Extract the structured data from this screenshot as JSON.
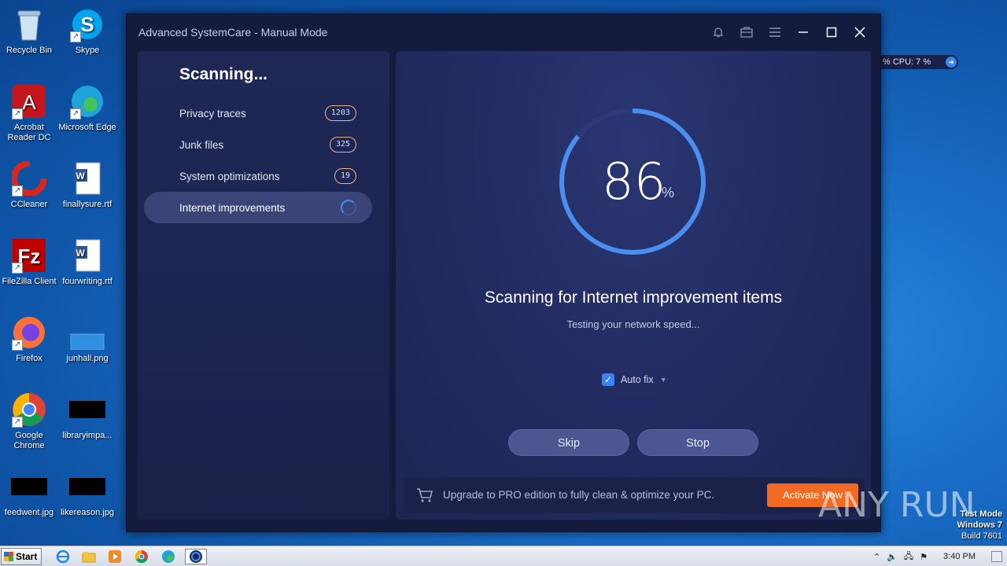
{
  "desktop": {
    "icons": [
      {
        "label": "Recycle Bin"
      },
      {
        "label": "Skype"
      },
      {
        "label": "Acrobat Reader DC"
      },
      {
        "label": "Microsoft Edge"
      },
      {
        "label": "CCleaner"
      },
      {
        "label": "finallysure.rtf"
      },
      {
        "label": "FileZilla Client"
      },
      {
        "label": "fourwriting.rtf"
      },
      {
        "label": "Firefox"
      },
      {
        "label": "junhall.png"
      },
      {
        "label": "Google Chrome"
      },
      {
        "label": "libraryimpa..."
      },
      {
        "label": "feedwent.jpg"
      },
      {
        "label": "likereason.jpg"
      }
    ]
  },
  "window": {
    "title": "Advanced SystemCare - Manual Mode"
  },
  "left_panel": {
    "heading": "Scanning...",
    "items": [
      {
        "label": "Privacy traces",
        "count": "1203"
      },
      {
        "label": "Junk files",
        "count": "325"
      },
      {
        "label": "System optimizations",
        "count": "19"
      },
      {
        "label": "Internet improvements",
        "count": ""
      }
    ]
  },
  "progress": {
    "value": "86",
    "unit": "%",
    "fraction": 0.86
  },
  "status": {
    "heading": "Scanning for Internet improvement items",
    "sub": "Testing your network speed..."
  },
  "autofix": {
    "label": "Auto fix",
    "checked": true
  },
  "buttons": {
    "skip": "Skip",
    "stop": "Stop"
  },
  "promo": {
    "text": "Upgrade to PRO edition to fully clean & optimize your PC.",
    "cta": "Activate Now"
  },
  "monitor": {
    "text": "%   CPU: 7 %"
  },
  "watermark": {
    "brand": "ANY RUN",
    "mode": "Test Mode",
    "os": "Windows 7",
    "build": "Build 7601"
  },
  "taskbar": {
    "start": "Start",
    "clock": "3:40 PM"
  },
  "colors": {
    "accent": "#3b82f6",
    "cta": "#f26a21",
    "badge_border": "#e8b48a"
  }
}
